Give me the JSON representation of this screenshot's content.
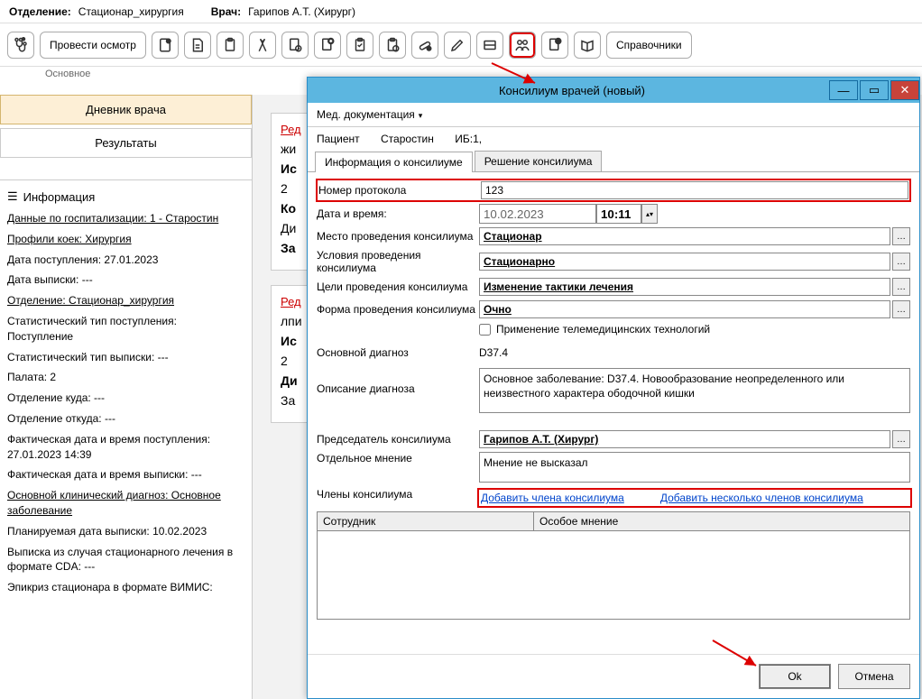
{
  "header": {
    "dept_label": "Отделение:",
    "dept_value": "Стационар_хирургия",
    "doctor_label": "Врач:",
    "doctor_value": "Гарипов А.Т. (Хирург)"
  },
  "toolbar": {
    "examine": "Провести осмотр",
    "refs": "Справочники",
    "sub_label": "Основное"
  },
  "sidebar": {
    "tab_diary": "Дневник врача",
    "tab_results": "Результаты",
    "info_header": "Информация",
    "lines": [
      {
        "text": "Данные по госпитализации: 1 - Старостин",
        "link": true
      },
      {
        "text": "Профили коек: Хирургия",
        "link": true
      },
      {
        "text": "Дата поступления: 27.01.2023",
        "link": false
      },
      {
        "text": "Дата выписки: ---",
        "link": false
      },
      {
        "text": "Отделение: Стационар_хирургия",
        "link": true
      },
      {
        "text": "Статистический тип поступления: Поступление",
        "link": false
      },
      {
        "text": "Статистический тип выписки: ---",
        "link": false
      },
      {
        "text": "Палата: 2",
        "link": false
      },
      {
        "text": "Отделение куда: ---",
        "link": false
      },
      {
        "text": "Отделение откуда: ---",
        "link": false
      },
      {
        "text": "Фактическая дата и время поступления: 27.01.2023 14:39",
        "link": false
      },
      {
        "text": "Фактическая дата и время выписки: ---",
        "link": false
      },
      {
        "text": "Основной клинический диагноз: Основное заболевание",
        "link": true
      },
      {
        "text": "Планируемая дата выписки: 10.02.2023",
        "link": false
      },
      {
        "text": "Выписка из случая стационарного лечения в формате CDA: ---",
        "link": false
      },
      {
        "text": "Эпикриз стационара в формате ВИМИС:",
        "link": false
      }
    ]
  },
  "mid": {
    "box1": {
      "link": "Ред",
      "lines": [
        "жи",
        "Ис",
        "2",
        "Ко",
        "Ди",
        "За"
      ]
    },
    "box2": {
      "link": "Ред",
      "lines": [
        "лпи",
        "Ис",
        "2",
        "Ди",
        "За"
      ]
    }
  },
  "modal": {
    "title": "Консилиум врачей (новый)",
    "menu": "Мед. документация",
    "patient_label": "Пациент",
    "patient_name": "Старостин",
    "ib_label": "ИБ:1,",
    "tabs": [
      "Информация о консилиуме",
      "Решение консилиума"
    ],
    "form": {
      "protocol_label": "Номер протокола",
      "protocol_value": "123",
      "datetime_label": "Дата и время:",
      "date_value": "10.02.2023",
      "time_value": "10:11",
      "place_label": "Место проведения консилиума",
      "place_value": "Стационар",
      "conditions_label": "Условия проведения консилиума",
      "conditions_value": "Стационарно",
      "goals_label": "Цели проведения консилиума",
      "goals_value": "Изменение тактики лечения",
      "form_label": "Форма проведения консилиума",
      "form_value": "Очно",
      "telemedicine_label": "Применение телемедицинских технологий",
      "diagnosis_label": "Основной диагноз",
      "diagnosis_value": "D37.4",
      "diagnosis_desc_label": "Описание диагноза",
      "diagnosis_desc_value": "Основное заболевание: D37.4. Новообразование неопределенного или неизвестного характера ободочной кишки",
      "chairman_label": "Председатель консилиума",
      "chairman_value": "Гарипов А.Т. (Хирург)",
      "opinion_label": "Отдельное мнение",
      "opinion_value": "Мнение не высказал",
      "members_label": "Члены консилиума",
      "add_member": "Добавить члена консилиума",
      "add_members": "Добавить несколько членов консилиума",
      "col_employee": "Сотрудник",
      "col_opinion": "Особое мнение"
    },
    "ok": "Ok",
    "cancel": "Отмена"
  }
}
